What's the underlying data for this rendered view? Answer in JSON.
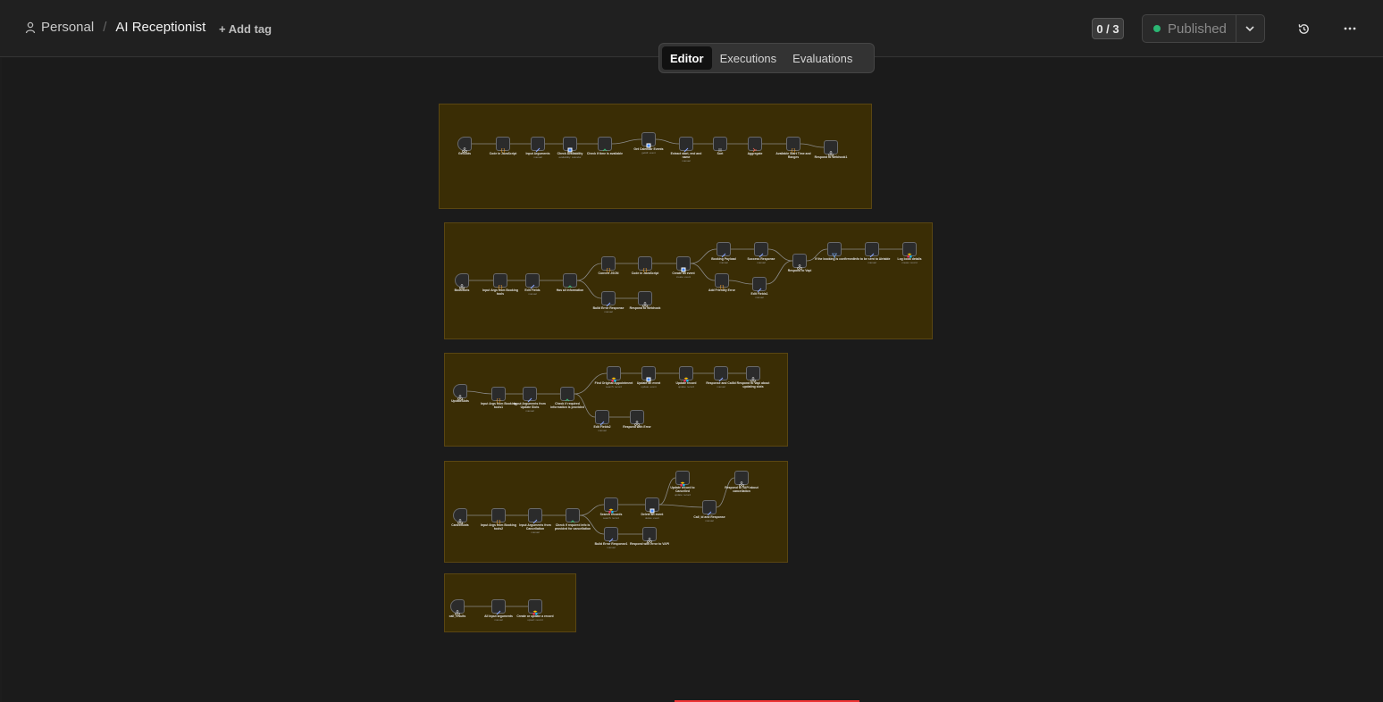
{
  "header": {
    "breadcrumb_project": "Personal",
    "workflow_title": "AI Receptionist",
    "add_tag_label": "+ Add tag",
    "counter": "0 / 3",
    "publish_label": "Published",
    "publish_status_color": "#2bb673",
    "icons": [
      "user-icon",
      "chevron-down-icon",
      "history-icon",
      "more-horizontal-icon"
    ]
  },
  "tabs": [
    {
      "label": "Editor",
      "active": true
    },
    {
      "label": "Executions",
      "active": false
    },
    {
      "label": "Evaluations",
      "active": false
    }
  ],
  "colors": {
    "canvas_bg": "#1b1b1b",
    "sticky_bg": "#3a2d05",
    "node_bg": "#2b2b2b",
    "accent_red": "#e33"
  },
  "groups": [
    {
      "nodes": [
        {
          "label": "GetSlots",
          "sub": "",
          "icon": "webhook-icon"
        },
        {
          "label": "Code in JavaScript",
          "sub": "",
          "icon": "code-icon"
        },
        {
          "label": "Input Arguments",
          "sub": "manual",
          "icon": "edit-icon"
        },
        {
          "label": "Check Availability",
          "sub": "availability: calendar",
          "icon": "calendar-icon"
        },
        {
          "label": "Check if time is available",
          "sub": "",
          "icon": "if-icon"
        },
        {
          "label": "Get Calendar Events",
          "sub": "getAll: event",
          "icon": "calendar-icon"
        },
        {
          "label": "Extract start, end and name",
          "sub": "manual",
          "icon": "edit-icon"
        },
        {
          "label": "Sort",
          "sub": "",
          "icon": "sort-icon"
        },
        {
          "label": "Aggregate",
          "sub": "",
          "icon": "aggregate-icon"
        },
        {
          "label": "Available Start Time and Ranges",
          "sub": "",
          "icon": "code-icon"
        },
        {
          "label": "Respond to Webhook1",
          "sub": "",
          "icon": "webhook-icon"
        }
      ]
    },
    {
      "nodes": [
        {
          "label": "BookSlots",
          "sub": "",
          "icon": "webhook-icon"
        },
        {
          "label": "Input Args from Booking tools",
          "sub": "",
          "icon": "code-icon"
        },
        {
          "label": "Edit Fields",
          "sub": "manual",
          "icon": "edit-icon"
        },
        {
          "label": "Has all information",
          "sub": "",
          "icon": "if-icon"
        },
        {
          "label": "Build Error Response",
          "sub": "manual",
          "icon": "edit-icon"
        },
        {
          "label": "Respond to Webhook",
          "sub": "",
          "icon": "webhook-icon"
        },
        {
          "label": "Convert JSON",
          "sub": "",
          "icon": "code-icon"
        },
        {
          "label": "Code in JavaScript",
          "sub": "",
          "icon": "code-icon"
        },
        {
          "label": "Create an event",
          "sub": "create: event",
          "icon": "calendar-icon"
        },
        {
          "label": "Add Friendly Error",
          "sub": "",
          "icon": "code-icon"
        },
        {
          "label": "Booking Payload",
          "sub": "manual",
          "icon": "edit-icon"
        },
        {
          "label": "Success Response",
          "sub": "manual",
          "icon": "edit-icon"
        },
        {
          "label": "Edit Fields1",
          "sub": "manual",
          "icon": "edit-icon"
        },
        {
          "label": "Respond to Vapi",
          "sub": "",
          "icon": "webhook-icon"
        },
        {
          "label": "If the booking is confirmed",
          "sub": "",
          "icon": "filter-icon"
        },
        {
          "label": "Info to be sent to Airtable",
          "sub": "manual",
          "icon": "edit-icon"
        },
        {
          "label": "Log book details",
          "sub": "create: record",
          "icon": "airtable-icon"
        }
      ]
    },
    {
      "nodes": [
        {
          "label": "UpdateSlots",
          "sub": "",
          "icon": "webhook-icon"
        },
        {
          "label": "Input Args from Booking tools1",
          "sub": "",
          "icon": "code-icon"
        },
        {
          "label": "Input Arguments from Update Slots",
          "sub": "manual",
          "icon": "edit-icon"
        },
        {
          "label": "Check if required information is provided",
          "sub": "",
          "icon": "if-icon"
        },
        {
          "label": "Edit Fields2",
          "sub": "manual",
          "icon": "edit-icon"
        },
        {
          "label": "Respond with Error",
          "sub": "",
          "icon": "webhook-icon"
        },
        {
          "label": "Find Original Appointment",
          "sub": "search: record",
          "icon": "airtable-icon"
        },
        {
          "label": "Update an event",
          "sub": "update: event",
          "icon": "calendar-icon"
        },
        {
          "label": "Update record",
          "sub": "update: record",
          "icon": "airtable-icon"
        },
        {
          "label": "Response and CallId",
          "sub": "manual",
          "icon": "edit-icon"
        },
        {
          "label": "Respond to Vapi about updating slots",
          "sub": "",
          "icon": "webhook-icon"
        }
      ]
    },
    {
      "nodes": [
        {
          "label": "CancelSlots",
          "sub": "",
          "icon": "webhook-icon"
        },
        {
          "label": "Input Args from Booking tools2",
          "sub": "",
          "icon": "code-icon"
        },
        {
          "label": "Input Arguments from Cancellation",
          "sub": "manual",
          "icon": "edit-icon"
        },
        {
          "label": "Check if required info is provided for cancellation",
          "sub": "",
          "icon": "if-icon"
        },
        {
          "label": "Build Error Response1",
          "sub": "manual",
          "icon": "edit-icon"
        },
        {
          "label": "Respond with error to VAPI",
          "sub": "",
          "icon": "webhook-icon"
        },
        {
          "label": "Search records",
          "sub": "search: record",
          "icon": "airtable-icon"
        },
        {
          "label": "Delete an event",
          "sub": "delete: event",
          "icon": "calendar-icon"
        },
        {
          "label": "Update record to Cancelled",
          "sub": "update: record",
          "icon": "airtable-icon"
        },
        {
          "label": "Call_id and Response",
          "sub": "manual",
          "icon": "edit-icon"
        },
        {
          "label": "Respond to VAPI about cancellation",
          "sub": "",
          "icon": "webhook-icon"
        }
      ]
    },
    {
      "nodes": [
        {
          "label": "call_results",
          "sub": "",
          "icon": "webhook-icon"
        },
        {
          "label": "All Input arguments",
          "sub": "manual",
          "icon": "edit-icon"
        },
        {
          "label": "Create or update a record",
          "sub": "upsert: record",
          "icon": "airtable-icon"
        }
      ]
    }
  ]
}
